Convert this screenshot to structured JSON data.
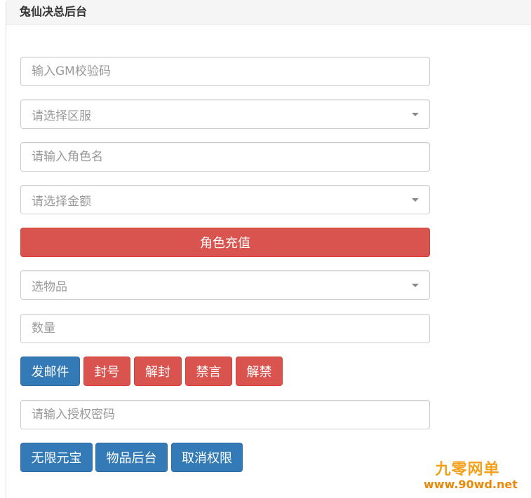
{
  "panel": {
    "title": "兔仙决总后台"
  },
  "fields": {
    "gm_code_placeholder": "输入GM校验码",
    "server_placeholder": "请选择区服",
    "role_name_placeholder": "请输入角色名",
    "amount_placeholder": "请选择金额",
    "item_placeholder": "选物品",
    "quantity_placeholder": "数量",
    "auth_code_placeholder": "请输入授权密码"
  },
  "buttons": {
    "recharge": "角色充值",
    "send_mail": "发邮件",
    "ban": "封号",
    "unban": "解封",
    "mute": "禁言",
    "unmute": "解禁",
    "unlimited_yuanbao": "无限元宝",
    "item_backend": "物品后台",
    "revoke_permission": "取消权限"
  },
  "watermark": {
    "cn": "九零网单",
    "url": "www.90wd.net"
  },
  "colors": {
    "danger": "#d9534f",
    "primary": "#337ab7",
    "watermark": "#f5a01a"
  }
}
